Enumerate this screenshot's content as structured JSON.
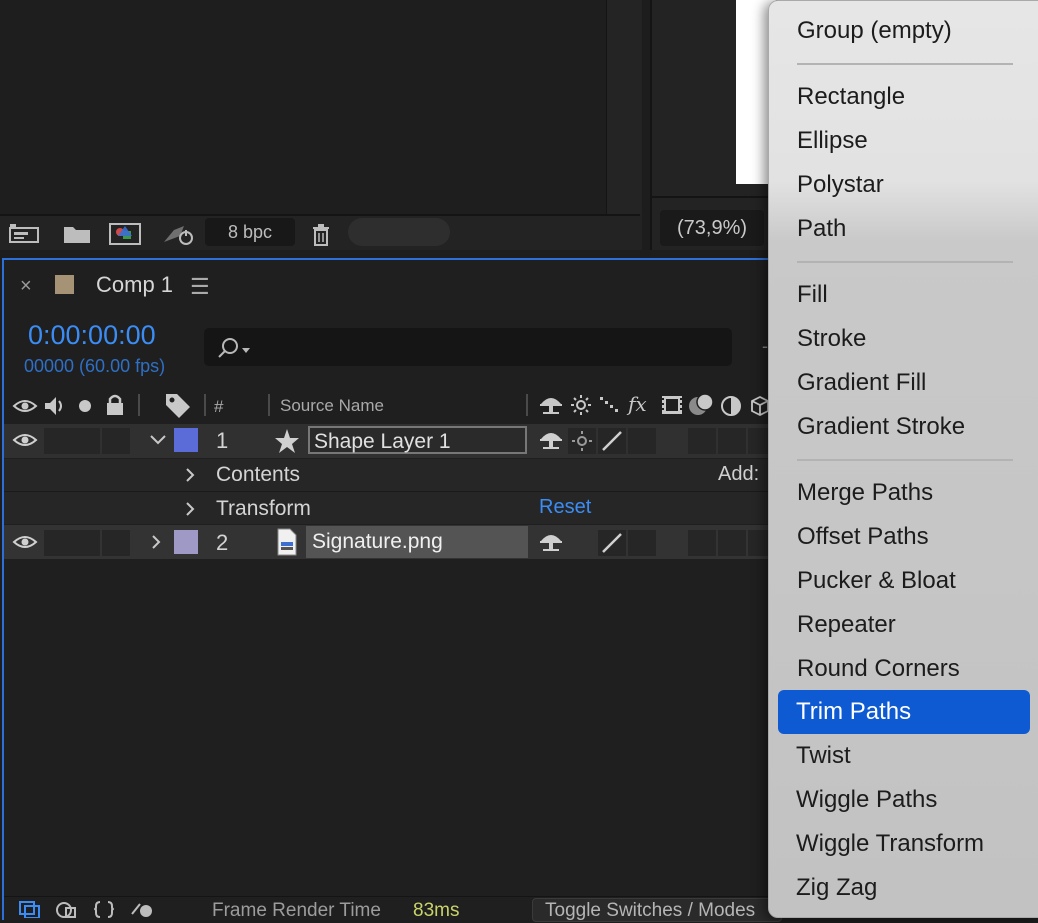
{
  "project": {
    "bpc": "8 bpc"
  },
  "viewer": {
    "zoom": "(73,9%)"
  },
  "timeline": {
    "tab_close": "×",
    "comp_name": "Comp 1",
    "tab_menu": "☰",
    "timecode": "0:00:00:00",
    "frame_info": "00000 (60.00 fps)",
    "search_placeholder": "",
    "columns": {
      "number": "#",
      "source_name": "Source Name"
    },
    "layers": [
      {
        "number": "1",
        "name": "Shape Layer 1",
        "label_color": "#5b6bd8",
        "expanded": true
      },
      {
        "number": "2",
        "name": "Signature.png",
        "label_color": "#9f9ac5",
        "expanded": false
      }
    ],
    "shape_props": {
      "contents": "Contents",
      "transform": "Transform",
      "reset": "Reset",
      "add": "Add:"
    },
    "footer": {
      "render_label": "Frame Render Time",
      "render_value": "83ms",
      "toggle": "Toggle Switches / Modes"
    }
  },
  "add_menu": {
    "items": [
      "Group (empty)",
      "Rectangle",
      "Ellipse",
      "Polystar",
      "Path",
      "Fill",
      "Stroke",
      "Gradient Fill",
      "Gradient Stroke",
      "Merge Paths",
      "Offset Paths",
      "Pucker & Bloat",
      "Repeater",
      "Round Corners",
      "Trim Paths",
      "Twist",
      "Wiggle Paths",
      "Wiggle Transform",
      "Zig Zag"
    ],
    "highlighted": "Trim Paths",
    "highlight_color": "#0d5ad3"
  }
}
